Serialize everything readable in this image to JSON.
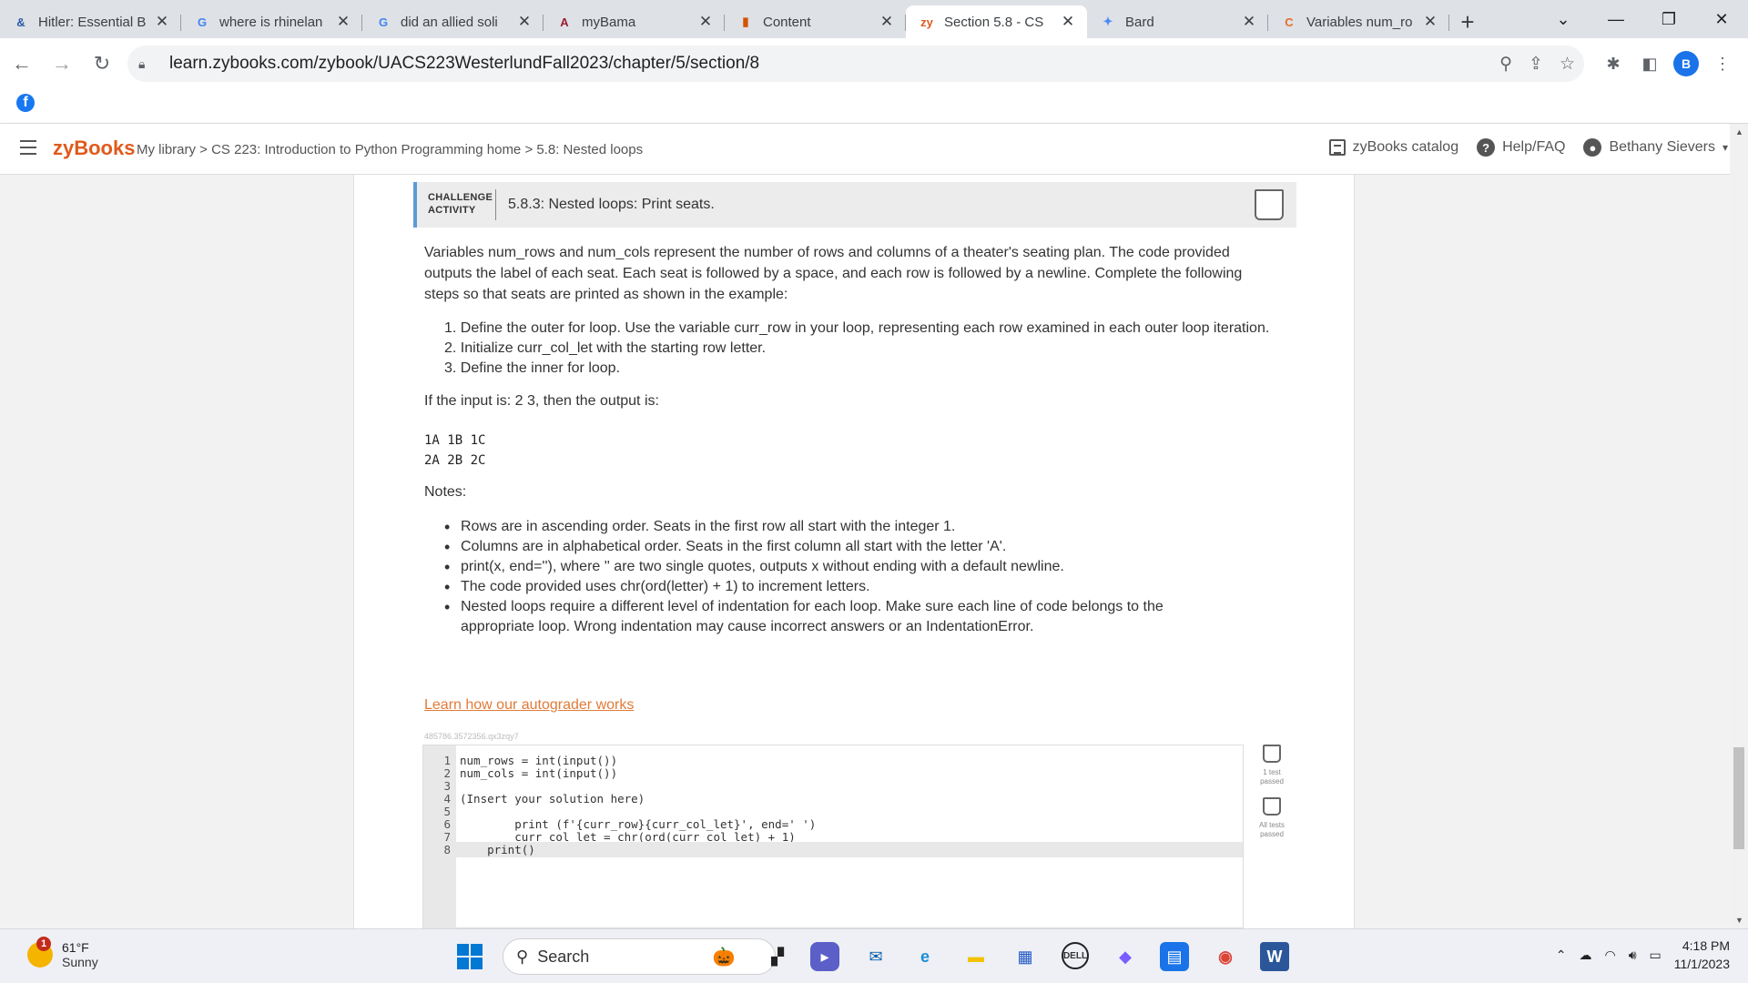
{
  "browser": {
    "tabs": [
      {
        "title": "Hitler: Essential B",
        "favicon": "&",
        "color": "#2b5aa8",
        "active": false
      },
      {
        "title": "where is rhinelan",
        "favicon": "G",
        "color": "#4285f4",
        "active": false
      },
      {
        "title": "did an allied soli",
        "favicon": "G",
        "color": "#4285f4",
        "active": false
      },
      {
        "title": "myBama",
        "favicon": "A",
        "color": "#9e1b32",
        "active": false
      },
      {
        "title": "Content",
        "favicon": "▮",
        "color": "#d35400",
        "active": false
      },
      {
        "title": "Section 5.8 - CS",
        "favicon": "zy",
        "color": "#e05a1c",
        "active": true
      },
      {
        "title": "Bard",
        "favicon": "✦",
        "color": "#4c8bf5",
        "active": false
      },
      {
        "title": "Variables num_ro",
        "favicon": "C",
        "color": "#e86c2b",
        "active": false
      }
    ],
    "new_tab_label": "+",
    "url": "learn.zybooks.com/zybook/UACS223WesterlundFall2023/chapter/5/section/8",
    "profile_initial": "B",
    "bookmark_icon": "facebook-icon"
  },
  "header": {
    "logo": "zyBooks",
    "breadcrumb": "My library > CS 223: Introduction to Python Programming home > 5.8: Nested loops",
    "catalog": "zyBooks catalog",
    "help": "Help/FAQ",
    "user": "Bethany Sievers",
    "user_caret": "▾"
  },
  "activity": {
    "type_line1": "CHALLENGE",
    "type_line2": "ACTIVITY",
    "title": "5.8.3: Nested loops: Print seats.",
    "description": "Variables num_rows and num_cols represent the number of rows and columns of a theater's seating plan. The code provided outputs the label of each seat. Each seat is followed by a space, and each row is followed by a newline. Complete the following steps so that seats are printed as shown in the example:",
    "steps": [
      "1. Define the outer for loop. Use the variable curr_row in your loop, representing each row examined in each outer loop iteration.",
      "2. Initialize curr_col_let with the starting row letter.",
      "3. Define the inner for loop."
    ],
    "input_line": "If the input is: 2 3, then the output is:",
    "sample_output": [
      "1A 1B 1C",
      "2A 2B 2C"
    ],
    "notes_label": "Notes:",
    "notes": [
      "Rows are in ascending order. Seats in the first row all start with the integer 1.",
      "Columns are in alphabetical order. Seats in the first column all start with the letter 'A'.",
      "print(x, end=''), where '' are two single quotes, outputs x without ending with a default newline.",
      "The code provided uses chr(ord(letter) + 1) to increment letters.",
      "Nested loops require a different level of indentation for each loop. Make sure each line of code belongs to the appropriate loop. Wrong indentation may cause incorrect answers or an IndentationError."
    ],
    "learn_link": "Learn how our autograder works",
    "code_id": "485786.3572356.qx3zqy7",
    "code_lines": [
      {
        "n": "1",
        "text": "num_rows = int(input())"
      },
      {
        "n": "2",
        "text": "num_cols = int(input())"
      },
      {
        "n": "3",
        "text": ""
      },
      {
        "n": "4",
        "text": "(Insert your solution here)"
      },
      {
        "n": "5",
        "text": ""
      },
      {
        "n": "6",
        "text": "        print (f'{curr_row}{curr_col_let}', end=' ')"
      },
      {
        "n": "7",
        "text": "        curr_col_let = chr(ord(curr_col_let) + 1)"
      },
      {
        "n": "8",
        "text": "    print()"
      }
    ],
    "test1_label": "1 test passed",
    "test2_label": "All tests passed"
  },
  "taskbar": {
    "temp": "61°F",
    "condition": "Sunny",
    "alert_count": "1",
    "search_label": "Search",
    "time": "4:18 PM",
    "date": "11/1/2023"
  }
}
